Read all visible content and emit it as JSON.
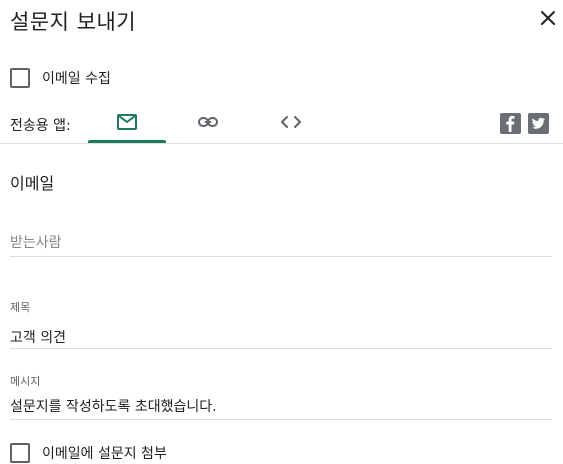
{
  "dialog": {
    "title": "설문지 보내기"
  },
  "collect_email": {
    "label": "이메일 수집",
    "checked": false
  },
  "send_via": {
    "label": "전송용 앱:",
    "tabs": [
      {
        "name": "email",
        "icon": "mail-icon",
        "active": true
      },
      {
        "name": "link",
        "icon": "link-icon",
        "active": false
      },
      {
        "name": "embed",
        "icon": "embed-code-icon",
        "active": false
      }
    ],
    "social": [
      {
        "name": "facebook",
        "icon": "facebook-icon"
      },
      {
        "name": "twitter",
        "icon": "twitter-icon"
      }
    ],
    "accent_color": "#1e7b5a"
  },
  "email_form": {
    "section_title": "이메일",
    "to": {
      "placeholder": "받는사람",
      "value": ""
    },
    "subject": {
      "label": "제목",
      "value": "고객 의견"
    },
    "message": {
      "label": "메시지",
      "value": "설문지를 작성하도록 초대했습니다."
    },
    "attach": {
      "label": "이메일에 설문지 첨부",
      "checked": false
    }
  }
}
